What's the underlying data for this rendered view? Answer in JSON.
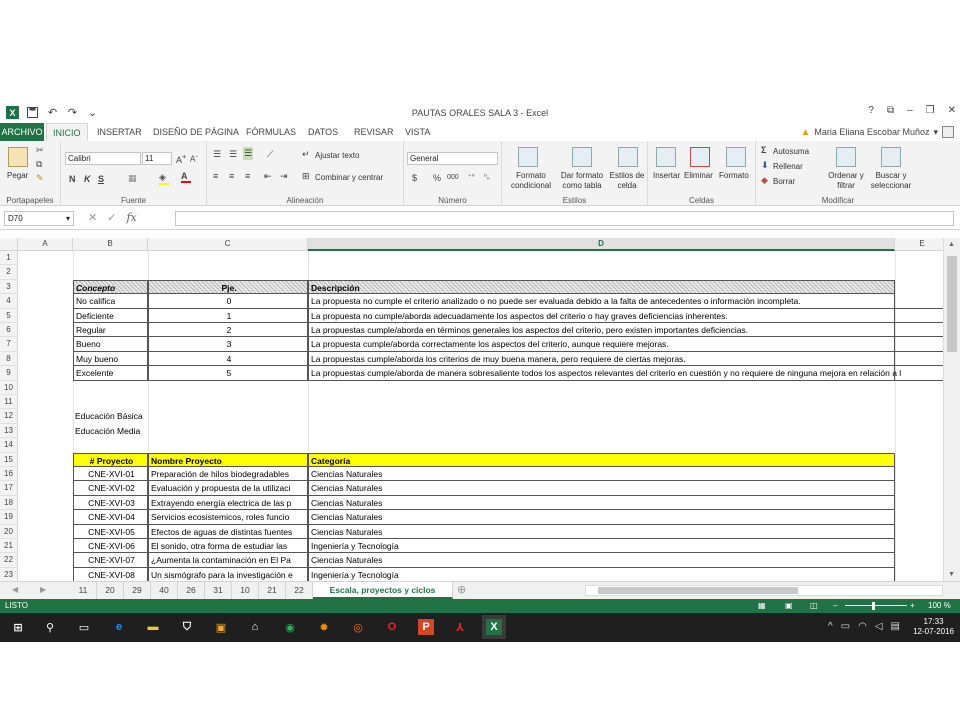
{
  "window": {
    "title": "PAUTAS ORALES SALA  3 - Excel",
    "controls": [
      "?",
      "⧉",
      "–",
      "❐",
      "✕"
    ]
  },
  "qat": {
    "undo": "↶",
    "redo": "↷",
    "more": "⌄"
  },
  "tabs": [
    {
      "label": "ARCHIVO"
    },
    {
      "label": "INICIO"
    },
    {
      "label": "INSERTAR"
    },
    {
      "label": "DISEÑO DE PÁGINA"
    },
    {
      "label": "FÓRMULAS"
    },
    {
      "label": "DATOS"
    },
    {
      "label": "REVISAR"
    },
    {
      "label": "VISTA"
    }
  ],
  "user": "Maria Eliana Escobar Muñoz",
  "ribbon": {
    "clipboard": {
      "paste": "Pegar",
      "label": "Portapapeles"
    },
    "font": {
      "name": "Calibri",
      "size": "11",
      "bold": "N",
      "italic": "K",
      "underline": "S",
      "label": "Fuente"
    },
    "alignment": {
      "wrap": "Ajustar texto",
      "merge": "Combinar y centrar",
      "label": "Alineación"
    },
    "number": {
      "format": "General",
      "currency": "$",
      "percent": "%",
      "thousands": "000",
      "label": "Número"
    },
    "styles": {
      "cond": "Formato condicional",
      "table": "Dar formato como tabla",
      "cell": "Estilos de celda",
      "label": "Estilos"
    },
    "cells": {
      "insert": "Insertar",
      "delete": "Eliminar",
      "format": "Formato",
      "label": "Celdas"
    },
    "editing": {
      "autosum": "Autosuma",
      "fill": "Rellenar",
      "clear": "Borrar",
      "sort": "Ordenar y filtrar",
      "find": "Buscar y seleccionar",
      "label": "Modificar"
    }
  },
  "formula_bar": {
    "name_box": "D70",
    "fx": "fx",
    "value": ""
  },
  "columns": [
    {
      "label": "A"
    },
    {
      "label": "B"
    },
    {
      "label": "C"
    },
    {
      "label": "D"
    },
    {
      "label": "E"
    }
  ],
  "rows": [
    {
      "label": "1"
    },
    {
      "label": "2"
    },
    {
      "label": "3"
    },
    {
      "label": "4"
    },
    {
      "label": "5"
    },
    {
      "label": "6"
    },
    {
      "label": "7"
    },
    {
      "label": "8"
    },
    {
      "label": "9"
    },
    {
      "label": "10"
    },
    {
      "label": "11"
    },
    {
      "label": "12"
    },
    {
      "label": "13"
    },
    {
      "label": "14"
    },
    {
      "label": "15"
    },
    {
      "label": "16"
    },
    {
      "label": "17"
    },
    {
      "label": "18"
    },
    {
      "label": "19"
    },
    {
      "label": "20"
    },
    {
      "label": "21"
    },
    {
      "label": "22"
    },
    {
      "label": "23"
    }
  ],
  "scale_table": {
    "headers": [
      "Concepto",
      "Pje.",
      "Descripción"
    ],
    "rows": [
      [
        "No califica",
        "0",
        "La propuesta no cumple el criterio analizado o no puede ser evaluada debido a la falta de antecedentes o información incompleta."
      ],
      [
        "Deficiente",
        "1",
        "La propuesta no cumple/aborda adecuadamente los aspectos del criterio o hay graves deficiencias inherentes."
      ],
      [
        "Regular",
        "2",
        "La propuestas cumple/aborda en términos generales los aspectos del criterio, pero existen importantes deficiencias."
      ],
      [
        "Bueno",
        "3",
        "La propuesta cumple/aborda correctamente los aspectos del criterio, aunque requiere mejoras."
      ],
      [
        "Muy bueno",
        "4",
        "La propuestas cumple/aborda los criterios de muy buena manera, pero requiere de ciertas mejoras."
      ],
      [
        "Excelente",
        "5",
        "La propuestas cumple/aborda de manera sobresaliente todos los aspectos relevantes del criterio en cuestión y no requiere de ninguna mejora en relación a l"
      ]
    ]
  },
  "levels": [
    "Educación Básica",
    "Educación Media"
  ],
  "projects": {
    "headers": [
      "# Proyecto",
      "Nombre Proyecto",
      "Categoría"
    ],
    "rows": [
      [
        "CNE-XVI-01",
        "Preparación de hilos biodegradables",
        "Ciencias Naturales"
      ],
      [
        "CNE-XVI-02",
        "Evaluación y propuesta de la utilizaci",
        "Ciencias Naturales"
      ],
      [
        "CNE-XVI-03",
        "Extrayendo energía electrica de las p",
        "Ciencias Naturales"
      ],
      [
        "CNE-XVI-04",
        "Servicios ecosistemicos, roles funcio",
        "Ciencias Naturales"
      ],
      [
        "CNE-XVI-05",
        "Efectos de aguas de distintas fuentes",
        "Ciencias Naturales"
      ],
      [
        "CNE-XVI-06",
        "El sonido, otra forma de estudiar las",
        "Ingeniería y Tecnología"
      ],
      [
        "CNE-XVI-07",
        "¿Aumenta la contaminación en El Pa",
        "Ciencias Naturales"
      ],
      [
        "CNE-XVI-08",
        "Un sismógrafo para la investigación e",
        "Ingeniería y Tecnología"
      ]
    ]
  },
  "sheets": [
    {
      "label": "11"
    },
    {
      "label": "20"
    },
    {
      "label": "29"
    },
    {
      "label": "40"
    },
    {
      "label": "26"
    },
    {
      "label": "31"
    },
    {
      "label": "10"
    },
    {
      "label": "21"
    },
    {
      "label": "22"
    },
    {
      "label": "Escala, proyectos y ciclos"
    }
  ],
  "status": {
    "mode": "LISTO",
    "zoom": "100 %"
  },
  "taskbar": {
    "time": "17:33",
    "date": "12-07-2016"
  },
  "colors": {
    "excel_green": "#217346",
    "header_yellow": "#ffff00",
    "hatch_gray": "#c0c0c0"
  }
}
